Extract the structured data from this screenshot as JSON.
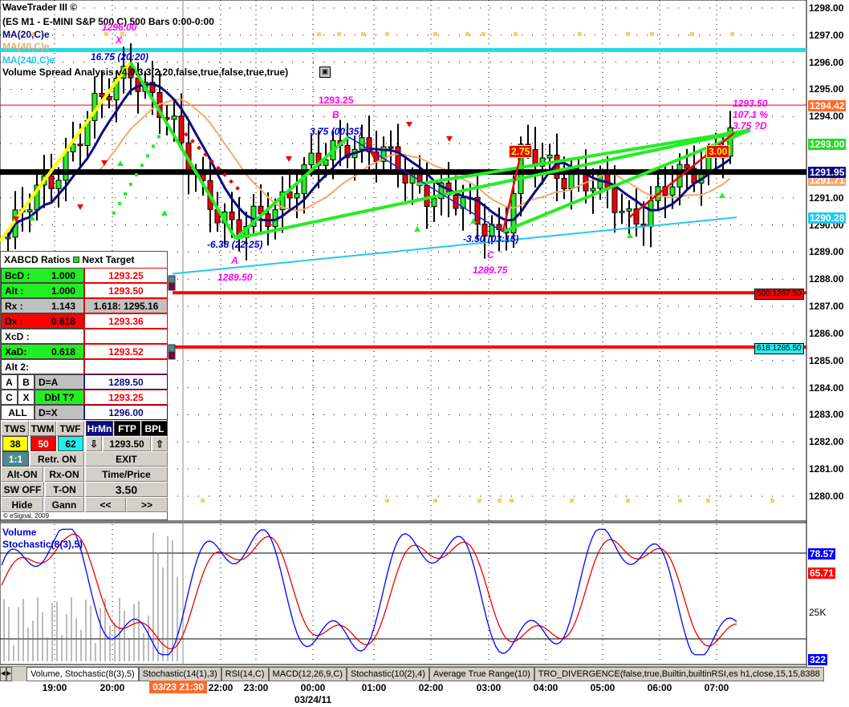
{
  "header": {
    "title": "WaveTrader III ©",
    "symbol": "(ES M1 - E-MINI S&P 500 C) 500 Bars 0:00-0:00",
    "ma20": "MA(20,C)e",
    "ma40": "MA(40,C)e",
    "ma240": "MA(240,C)e",
    "vsa": "Volume Spread Analysis v4.0.3.3(2,20,false,true,false,true,true)"
  },
  "annotations": {
    "x_price": "1296.00",
    "x_label": "X",
    "x_move": "16.75 (20:20)",
    "b_price": "1293.25",
    "b_label": "B",
    "b_move": "3.75 (00:35)",
    "a_move": "-6.38 (22:25)",
    "a_label": "A",
    "a_price": "1289.50",
    "c_move": "-3.50 (03:15)",
    "c_label": "C",
    "c_price": "1289.75",
    "box1": "2.75",
    "box2": "3.00",
    "d_price": "1293.50",
    "d_pct": "107.1 %",
    "d_move": "3.75 ?D",
    "lvl500": "500:1287.50",
    "lvl618": "618:1285.50"
  },
  "price_axis": [
    "1298.00",
    "1297.00",
    "1296.00",
    "1295.00",
    "1294.00",
    "1293.00",
    "1292.00",
    "1291.00",
    "1290.00",
    "1289.00",
    "1288.00",
    "1287.00",
    "1286.00",
    "1285.00",
    "1284.00",
    "1283.00",
    "1282.00",
    "1281.00",
    "1280.00"
  ],
  "badges": [
    {
      "text": "1294.42",
      "color": "#ff6a2a"
    },
    {
      "text": "1293.00",
      "color": "#22dd22"
    },
    {
      "text": "1291.71",
      "color": "#f6a86a"
    },
    {
      "text": "1291.95",
      "color": "#0a0a80"
    },
    {
      "text": "1290.28",
      "color": "#22c8f0"
    }
  ],
  "panel": {
    "header": "XABCD Ratios",
    "header2": "Next Target",
    "rows": [
      {
        "l": "BcD :",
        "v": "1.000",
        "t": "1293.25"
      },
      {
        "l": "Alt  :",
        "v": "1.000",
        "t": "1293.50"
      },
      {
        "l": "Rx  :",
        "v": "1.143",
        "t": "1.618: 1295.16"
      },
      {
        "l": "Dx  :",
        "v": "0.618",
        "t": "1293.36"
      },
      {
        "l": "XcD :",
        "v": "",
        "t": ""
      },
      {
        "l": "XaD:",
        "v": "0.618",
        "t": "1293.52"
      },
      {
        "l": "Alt 2:",
        "v": "",
        "t": ""
      }
    ],
    "a": "A",
    "b": "B",
    "da": "D=A",
    "da_v": "1289.50",
    "c": "C",
    "x": "X",
    "dbl": "Dbl T?",
    "dbl_v": "1293.25",
    "all": "ALL",
    "dx": "D=X",
    "dx_v": "1296.00",
    "tws": "TWS",
    "twm": "TWM",
    "twf": "TWF",
    "hrmn": "HrMn",
    "ftp": "FTP",
    "bpl": "BPL",
    "n38": "38",
    "n50": "50",
    "n62": "62",
    "down": "⇩",
    "target": "1293.50",
    "up": "⇧",
    "ratio": "1:1",
    "retr": "Retr. ON",
    "exit": "EXIT",
    "alt_on": "Alt-ON",
    "rx_on": "Rx-ON",
    "time_price": "Time/Price",
    "sw_off": "SW OFF",
    "t_on": "T-ON",
    "step": "3.50",
    "hide": "Hide",
    "gann": "Gann",
    "prev": "<<",
    "next": ">>",
    "copyright": "© eSignal, 2009"
  },
  "lower": {
    "volume": "Volume",
    "stoch": "Stochastic(8(3),5)",
    "k": "78.57",
    "d": "65.71",
    "vol_tick": "25K",
    "vol_last": "322"
  },
  "tabs": [
    "Volume, Stochastic(8(3),5)",
    "Stochastic(14(1),3)",
    "RSI(14,C)",
    "MACD(12,26,9,C)",
    "Stochastic(10(2),4)",
    "Average True Range(10)",
    "TRO_DIVERGENCE(false,true,Builtin,builtinRSI,es h1,close,15,15,8388"
  ],
  "time_axis": {
    "ticks": [
      "19:00",
      "20:00",
      "22:00",
      "23:00",
      "00:00",
      "01:00",
      "02:00",
      "03:00",
      "04:00",
      "05:00",
      "06:00",
      "07:00"
    ],
    "cursor": "03/23 21:30",
    "date": "03/24/11"
  },
  "chart_data": {
    "type": "candlestick",
    "pivots": [
      [
        "18:12",
        1289.6
      ],
      [
        "20:20",
        1296.0
      ],
      [
        "22:25",
        1289.5
      ],
      [
        "00:35",
        1293.25
      ],
      [
        "01:45",
        1291.6
      ],
      [
        "03:15",
        1289.75
      ],
      [
        "03:35",
        1292.5
      ],
      [
        "04:30",
        1291.9
      ],
      [
        "05:30",
        1290.3
      ],
      [
        "06:30",
        1291.8
      ],
      [
        "07:15",
        1293.4
      ]
    ],
    "levels": {
      "ma240_start": 1288.2,
      "ma240_end": 1290.28,
      "cyan_line": 1296.45,
      "red_line": 1294.42,
      "black_line": 1291.95,
      "fib500": 1287.5,
      "fib618": 1285.5
    },
    "ylim": [
      1280,
      1298
    ]
  }
}
